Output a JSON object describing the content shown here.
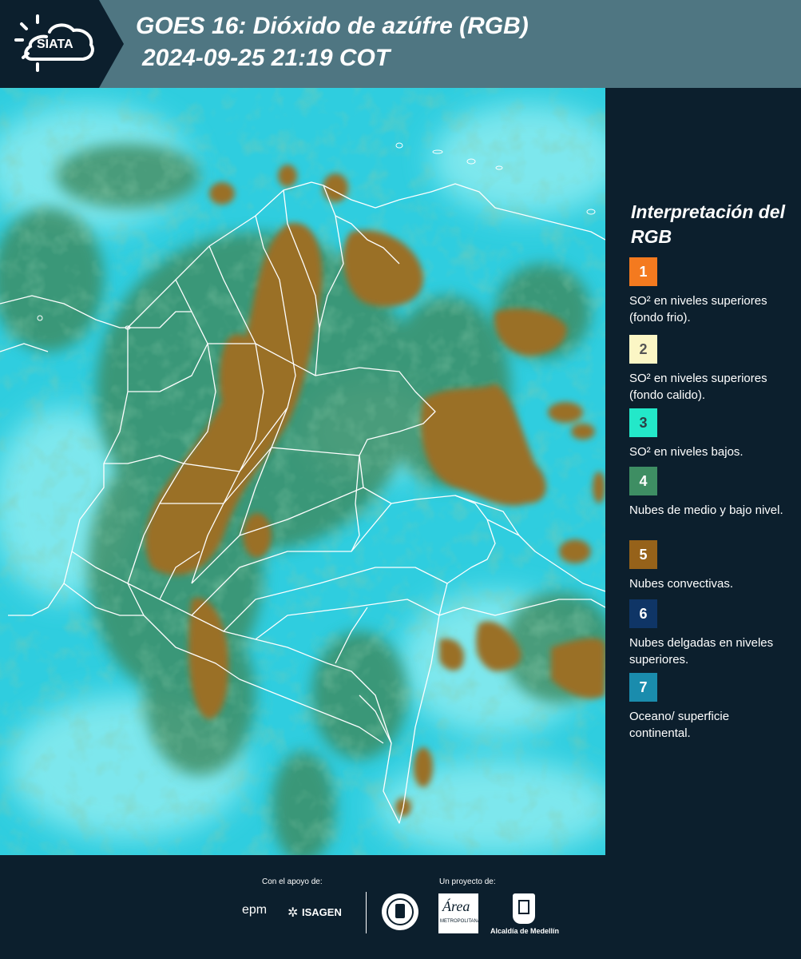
{
  "header": {
    "logo_text": "SIATA",
    "title_line1": "GOES 16: Dióxido de azúfre (RGB)",
    "title_line2": "2024-09-25 21:19 COT"
  },
  "legend": {
    "title": "Interpretación del RGB",
    "items": [
      {
        "number": "1",
        "color": "#f47a1f",
        "text_color": "#ffffff",
        "description": "SO² en niveles superiores (fondo frio)."
      },
      {
        "number": "2",
        "color": "#fbf6c5",
        "text_color": "#555555",
        "description": "SO² en niveles superiores (fondo calido)."
      },
      {
        "number": "3",
        "color": "#23e8c9",
        "text_color": "#2c3e44",
        "description": "SO² en niveles bajos."
      },
      {
        "number": "4",
        "color": "#3e8e63",
        "text_color": "#ffffff",
        "description": "Nubes de medio y bajo nivel."
      },
      {
        "number": "5",
        "color": "#96621a",
        "text_color": "#ffffff",
        "description": "Nubes convectivas."
      },
      {
        "number": "6",
        "color": "#0f3566",
        "text_color": "#ffffff",
        "description": "Nubes delgadas en niveles superiores."
      },
      {
        "number": "7",
        "color": "#1a8cad",
        "text_color": "#ffffff",
        "description": "Oceano/ superficie continental."
      }
    ]
  },
  "footer": {
    "support_label": "Con el apoyo de:",
    "project_label": "Un proyecto de:",
    "epm": "epm",
    "isagen": "ISAGEN",
    "area_metropolitana": "Área",
    "area_sub": "METROPOLITANA",
    "alcaldia": "Alcaldía de Medellín"
  },
  "map": {
    "colors": {
      "background": "#32cfe0",
      "haze": "#7ee8ee",
      "low_clouds": "#3e8a5f",
      "convective": "#9a6f27",
      "borders": "#ffffff"
    }
  }
}
